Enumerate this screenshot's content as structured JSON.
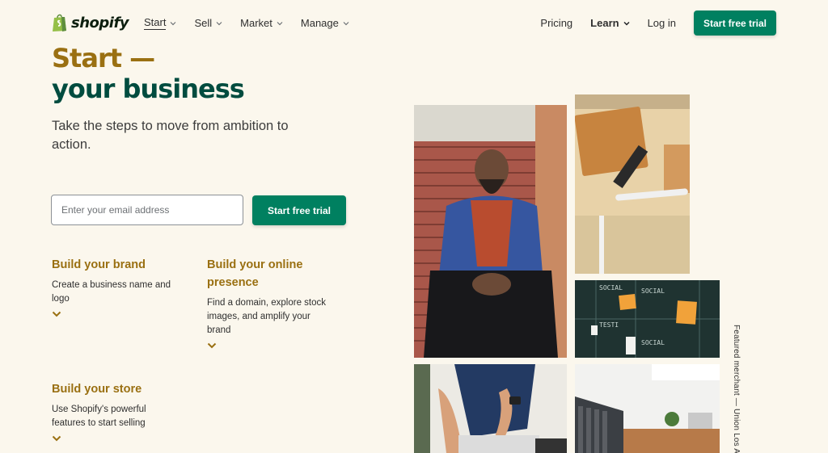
{
  "nav": {
    "logo_text": "shopify",
    "items": [
      {
        "label": "Start",
        "active": true
      },
      {
        "label": "Sell"
      },
      {
        "label": "Market"
      },
      {
        "label": "Manage"
      }
    ],
    "pricing": "Pricing",
    "learn": "Learn",
    "login": "Log in",
    "cta": "Start free trial"
  },
  "hero": {
    "title_line1": "Start —",
    "title_line2": "your business",
    "subtitle": "Take the steps to move from ambition to action.",
    "email_placeholder": "Enter your email address",
    "cta": "Start free trial"
  },
  "features": [
    {
      "title": "Build your brand",
      "text": "Create a business name and logo"
    },
    {
      "title": "Build your online presence",
      "text": "Find a domain, explore stock images, and amplify your brand"
    },
    {
      "title": "Build your store",
      "text": "Use Shopify's powerful features to start selling"
    }
  ],
  "featured_caption": "Featured merchant — Union Los An",
  "colors": {
    "brand_green": "#008060",
    "gold": "#9a7012",
    "dark_green": "#004c3f",
    "background": "#fbf7ed"
  }
}
